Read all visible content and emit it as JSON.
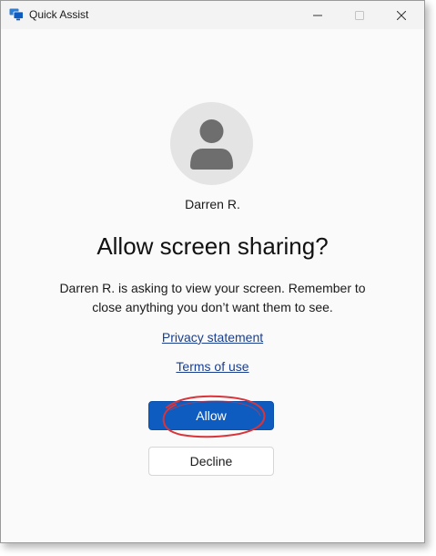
{
  "window": {
    "title": "Quick Assist",
    "icon": "quick-assist-app-icon",
    "controls": [
      "minimize-icon",
      "maximize-icon",
      "close-icon"
    ]
  },
  "prompt": {
    "avatar_icon": "person-icon",
    "user_name": "Darren R.",
    "heading": "Allow screen sharing?",
    "message": "Darren R. is asking to view your screen. Remember to close anything you don’t want them to see.",
    "privacy_link": "Privacy statement",
    "terms_link": "Terms of use"
  },
  "actions": {
    "allow_label": "Allow",
    "decline_label": "Decline"
  },
  "colors": {
    "accent": "#0f5cc0",
    "link": "#1a3f8f",
    "annotation": "#d9343a"
  }
}
